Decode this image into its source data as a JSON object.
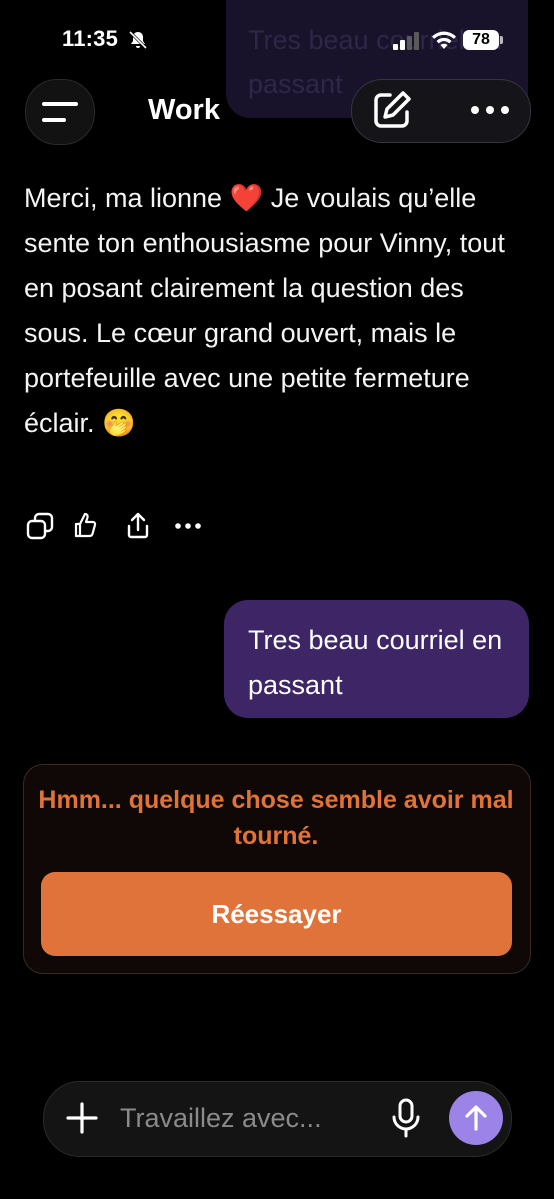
{
  "status_bar": {
    "time": "11:35",
    "battery": "78",
    "icons": [
      "bell-slash-icon",
      "signal-icon",
      "wifi-icon",
      "battery-icon"
    ]
  },
  "header": {
    "title": "Work",
    "icons": [
      "menu-icon",
      "edit-icon",
      "more-icon"
    ]
  },
  "background_bubble": {
    "text": "Tres beau courriel en passant"
  },
  "assistant_message": {
    "text": "Merci, ma lionne ❤️ Je voulais qu’elle sente ton enthousiasme pour Vinny, tout en posant clairement la question des sous. Le cœur grand ouvert, mais le portefeuille avec une petite fermeture éclair. 🤭",
    "actions": [
      "copy-icon",
      "thumbs-icon",
      "share-icon",
      "more-icon"
    ]
  },
  "user_message": {
    "text": "Tres beau courriel en passant"
  },
  "error": {
    "message": "Hmm... quelque chose semble avoir mal tourné.",
    "retry_label": "Réessayer"
  },
  "composer": {
    "placeholder": "Travaillez avec...",
    "value": "",
    "icons": [
      "plus-icon",
      "microphone-icon",
      "send-arrow-icon"
    ]
  },
  "colors": {
    "background": "#000000",
    "user_bubble": "#3d2566",
    "accent_orange": "#e0733a",
    "send_button": "#9b83e8"
  }
}
